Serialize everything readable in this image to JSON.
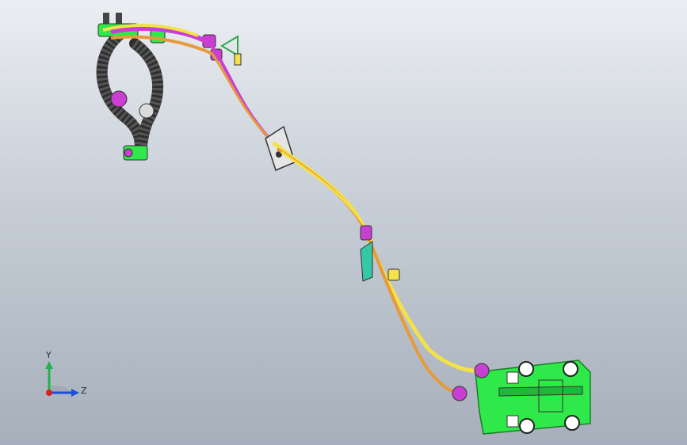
{
  "viewport": {
    "background_top": "#ebeef2",
    "background_bottom": "#a6afbb"
  },
  "triad": {
    "y_label": "Y",
    "z_label": "Z",
    "y_color": "#22b14c",
    "z_color": "#1f4fd8",
    "x_color": "#d81f26"
  },
  "colors": {
    "cable_yellow": "#f3e14a",
    "cable_orange": "#e79a3a",
    "cable_magenta": "#c93fd1",
    "hose_dark": "#2f2f2f",
    "bracket_green": "#2fe84a",
    "clip_teal": "#36c7a6"
  },
  "icons": {
    "triad": "coordinate-triad-icon"
  }
}
